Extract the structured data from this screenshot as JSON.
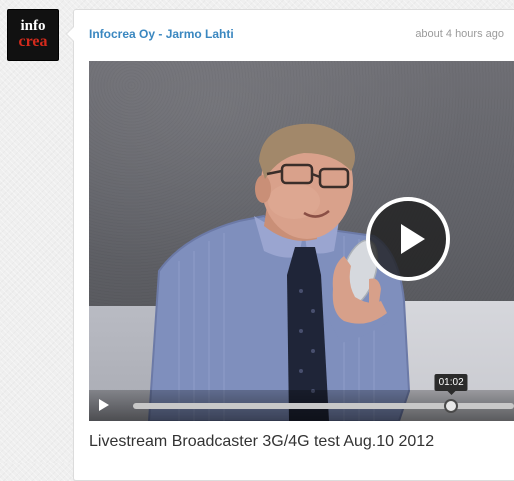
{
  "avatar": {
    "line1": "info",
    "line2": "crea"
  },
  "post": {
    "author": "Infocrea Oy - Jarmo Lahti",
    "timestamp": "about 4 hours ago",
    "video_title": "Livestream Broadcaster 3G/4G test Aug.10 2012"
  },
  "player": {
    "time_tooltip": "01:02",
    "progress_fraction": 0.835,
    "play_icon": "play-icon"
  },
  "colors": {
    "author_link": "#3a87c0",
    "avatar_bg": "#111111",
    "avatar_accent": "#d42a1c"
  }
}
